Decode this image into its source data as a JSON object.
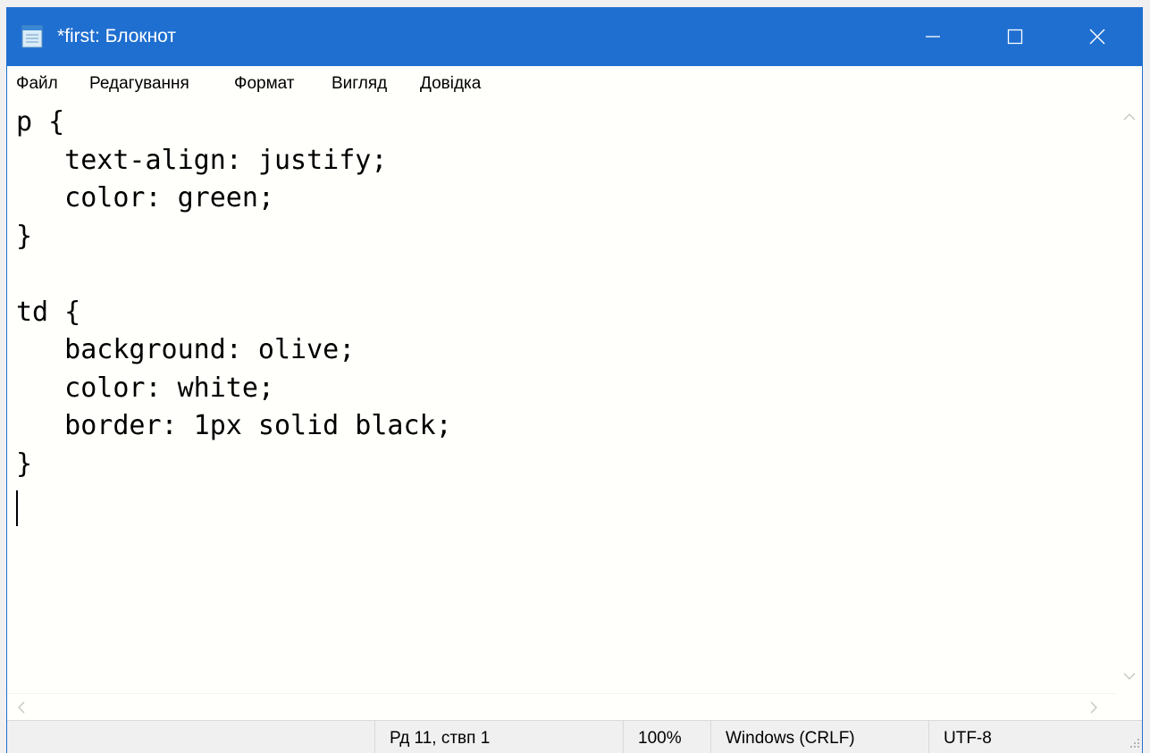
{
  "window": {
    "title": "*first: Блокнот",
    "titlebar_color": "#1f6fd1"
  },
  "menu": {
    "items": [
      "Файл",
      "Редагування",
      "Формат",
      "Вигляд",
      "Довідка"
    ]
  },
  "editor": {
    "content": "p {\n   text-align: justify;\n   color: green;\n}\n\ntd {\n   background: olive;\n   color: white;\n   border: 1px solid black;\n}"
  },
  "status": {
    "position": "Рд 11, ствп 1",
    "zoom": "100%",
    "line_endings": "Windows (CRLF)",
    "encoding": "UTF-8"
  },
  "icons": {
    "app": "notepad-icon",
    "minimize": "minimize-icon",
    "maximize": "maximize-icon",
    "close": "close-icon"
  }
}
